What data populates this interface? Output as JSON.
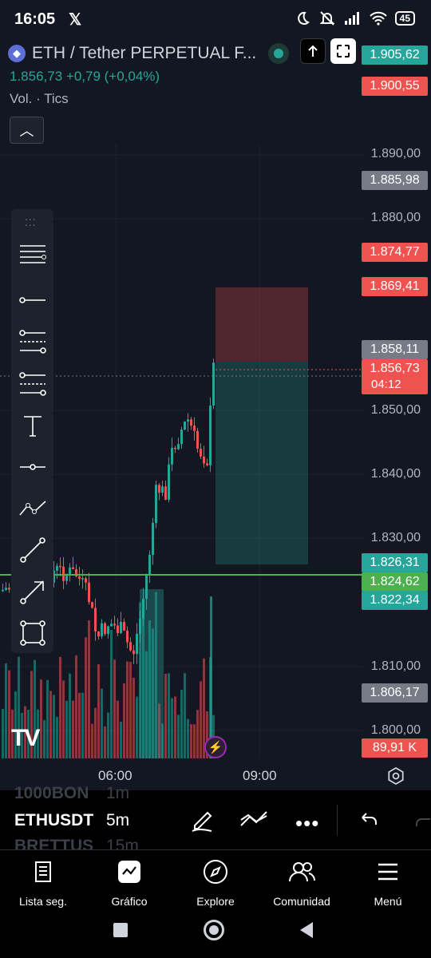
{
  "status_bar": {
    "time": "16:05",
    "x_logo": "𝕏",
    "battery": "45"
  },
  "header": {
    "symbol_title": "ETH / Tether PERPETUAL F...",
    "price_change": "1.856,73  +0,79 (+0,04%)",
    "volume_label": "Vol. · Tics",
    "collapse_glyph": "︿"
  },
  "price_axis": {
    "ticks": [
      "1.890,00",
      "1.880,00",
      "1.850,00",
      "1.840,00",
      "1.830,00",
      "1.810,00",
      "1.800,00"
    ],
    "labels": {
      "p1": "1.905,62",
      "p2": "1.900,55",
      "p3": "1.885,98",
      "p4": "1.874,77",
      "p5": "1.869,41",
      "p6": "1.858,11",
      "p7_price": "1.856,73",
      "p7_time": "04:12",
      "p8": "1.826,31",
      "p9": "1.824,62",
      "p10": "1.822,34",
      "p11": "1.806,17",
      "p12": "89,91 K"
    }
  },
  "time_axis": {
    "t1": "06:00",
    "t2": "09:00"
  },
  "watermark": "TV",
  "symbol_picker": {
    "prev_symbol": "1000BON",
    "prev_tf": "1m",
    "symbol": "ETHUSDT",
    "timeframe": "5m",
    "next_symbol": "BRETTUS",
    "next_tf": "15m"
  },
  "bottom_nav": {
    "watchlist": "Lista seg.",
    "chart": "Gráfico",
    "explore": "Explore",
    "community": "Comunidad",
    "menu": "Menú"
  },
  "colors": {
    "up": "#26a69a",
    "down": "#ef5350",
    "background": "#131722",
    "hline": "#4caf50"
  }
}
